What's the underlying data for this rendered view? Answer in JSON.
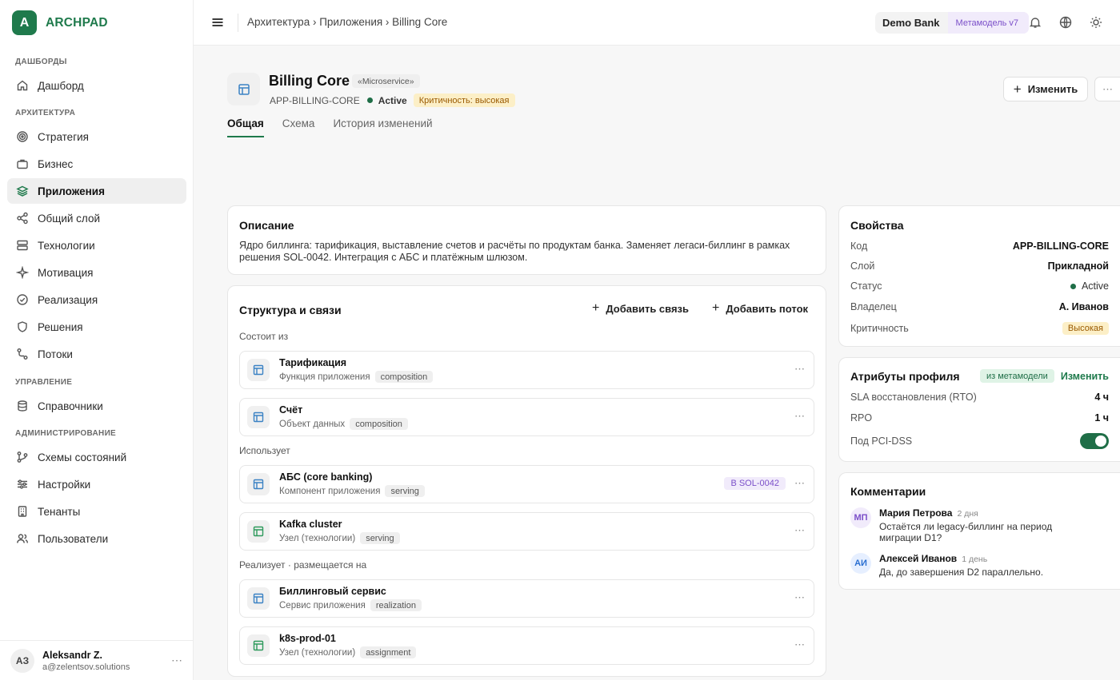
{
  "brand": {
    "logo_letter": "A",
    "name": "ARCHPAD"
  },
  "sidebar": {
    "sections": [
      {
        "title": "ДАШБОРДЫ"
      },
      {
        "title": "АРХИТЕКТУРА"
      },
      {
        "title": "УПРАВЛЕНИЕ"
      },
      {
        "title": "АДМИНИСТРИРОВАНИЕ"
      }
    ],
    "items": [
      {
        "label": "Дашборд",
        "icon": "home-icon"
      },
      {
        "label": "Стратегия",
        "icon": "target-icon"
      },
      {
        "label": "Бизнес",
        "icon": "briefcase-icon"
      },
      {
        "label": "Приложения",
        "icon": "layers-icon",
        "active": true
      },
      {
        "label": "Общий слой",
        "icon": "share-icon"
      },
      {
        "label": "Технологии",
        "icon": "server-icon"
      },
      {
        "label": "Мотивация",
        "icon": "sparkle-icon"
      },
      {
        "label": "Реализация",
        "icon": "check-circle-icon"
      },
      {
        "label": "Решения",
        "icon": "shield-icon"
      },
      {
        "label": "Потоки",
        "icon": "route-icon"
      },
      {
        "label": "Справочники",
        "icon": "database-icon"
      },
      {
        "label": "Схемы состояний",
        "icon": "git-branch-icon"
      },
      {
        "label": "Настройки",
        "icon": "sliders-icon"
      },
      {
        "label": "Тенанты",
        "icon": "building-icon"
      },
      {
        "label": "Пользователи",
        "icon": "users-icon"
      }
    ],
    "user": {
      "initials": "АЗ",
      "name": "Aleksandr Z.",
      "email": "a@zelentsov.solutions",
      "more": "⋯"
    }
  },
  "header": {
    "breadcrumb": "Архитектура › Приложения › Billing Core",
    "tenant_name": "Demo Bank",
    "tenant_tag": "Метамодель v7"
  },
  "app": {
    "title": "Billing Core",
    "stereotype": "«Microservice»",
    "code": "APP-BILLING-CORE",
    "status": "Active",
    "criticality": "Критичность: высокая",
    "edit_label": "Изменить",
    "more": "⋯",
    "tabs": [
      "Общая",
      "Схема",
      "История изменений"
    ]
  },
  "description": {
    "title": "Описание",
    "text": "Ядро биллинга: тарификация, выставление счетов и расчёты по продуктам банка. Заменяет легаси-биллинг в рамках решения SOL-0042. Интеграция с АБС и платёжным шлюзом."
  },
  "structure": {
    "title": "Структура и связи",
    "add_relation": "Добавить связь",
    "add_flow": "Добавить поток",
    "groups": [
      {
        "label": "Состоит из"
      },
      {
        "label": "Использует"
      },
      {
        "label": "Реализует · размещается на"
      }
    ],
    "relations": [
      {
        "name": "Тарификация",
        "type": "Функция приложения",
        "chip": "composition",
        "icon_color": "#3b82c4"
      },
      {
        "name": "Счёт",
        "type": "Объект данных",
        "chip": "composition",
        "icon_color": "#3b82c4"
      },
      {
        "name": "АБС (core banking)",
        "type": "Компонент приложения",
        "chip": "serving",
        "badge": "В SOL-0042",
        "icon_color": "#3b82c4"
      },
      {
        "name": "Kafka cluster",
        "type": "Узел (технологии)",
        "chip": "serving",
        "icon_color": "#2e9a5c"
      },
      {
        "name": "Биллинговый сервис",
        "type": "Сервис приложения",
        "chip": "realization",
        "icon_color": "#3b82c4"
      },
      {
        "name": "k8s-prod-01",
        "type": "Узел (технологии)",
        "chip": "assignment",
        "icon_color": "#2e9a5c"
      }
    ],
    "more": "⋯"
  },
  "properties": {
    "title": "Свойства",
    "rows": [
      {
        "key": "Код",
        "value": "APP-BILLING-CORE"
      },
      {
        "key": "Слой",
        "value": "Прикладной"
      },
      {
        "key": "Статус",
        "value": "Active"
      },
      {
        "key": "Владелец",
        "value": "А. Иванов"
      },
      {
        "key": "Критичность",
        "value": "Высокая"
      }
    ]
  },
  "profile": {
    "title": "Атрибуты профиля",
    "tag": "из метамодели",
    "change": "Изменить",
    "rows": [
      {
        "key": "SLA восстановления (RTO)",
        "value": "4 ч"
      },
      {
        "key": "RPO",
        "value": "1 ч"
      },
      {
        "key": "Под PCI-DSS",
        "value": true
      }
    ]
  },
  "comments": {
    "title": "Комментарии",
    "items": [
      {
        "initials": "МП",
        "author": "Мария Петрова",
        "time": "2 дня",
        "text": "Остаётся ли legacy-биллинг на период миграции D1?",
        "color": "#7b4fc9",
        "bg": "#f1ebfb"
      },
      {
        "initials": "АИ",
        "author": "Алексей Иванов",
        "time": "1 день",
        "text": "Да, до завершения D2 параллельно.",
        "color": "#2a6fd1",
        "bg": "#e6efff"
      }
    ]
  },
  "colors": {
    "accent": "#1f7a4c",
    "status_green": "#1f6e47",
    "purple": "#7b4fc9",
    "amber": "#9a5a00"
  }
}
